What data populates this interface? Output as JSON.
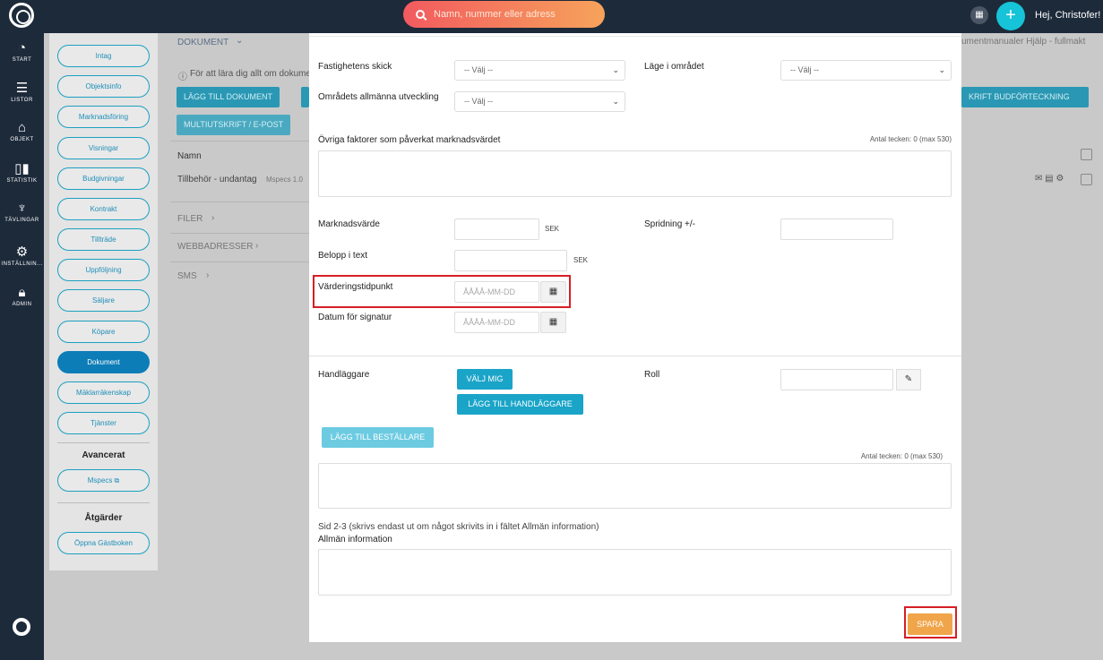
{
  "topbar": {
    "search_placeholder": "Namn, nummer eller adress",
    "greeting": "Hej, Christofer!"
  },
  "leftnav": {
    "items": [
      {
        "label": "START",
        "icon": "speedometer-icon"
      },
      {
        "label": "LISTOR",
        "icon": "list-icon"
      },
      {
        "label": "OBJEKT",
        "icon": "home-icon"
      },
      {
        "label": "STATISTIK",
        "icon": "bar-chart-icon"
      },
      {
        "label": "TÄVLINGAR",
        "icon": "trophy-icon"
      },
      {
        "label": "INSTÄLLNIN...",
        "icon": "gear-icon"
      },
      {
        "label": "ADMIN",
        "icon": "lock-icon"
      }
    ]
  },
  "subnav": {
    "items": [
      "Intag",
      "Objektsinfo",
      "Marknadsföring",
      "Visningar",
      "Budgivningar",
      "Kontrakt",
      "Tillträde",
      "Uppföljning",
      "Säljare",
      "Köpare",
      "Dokument",
      "Mäklarräkenskap",
      "Tjänster"
    ],
    "active": "Dokument",
    "advanced_heading": "Avancerat",
    "mspecs_label": "Mspecs ⧉",
    "actions_heading": "Åtgärder",
    "guestbook_label": "Öppna Gästboken"
  },
  "background": {
    "section_title": "DOKUMENT",
    "info_text": "För att lära dig allt om dokumen",
    "add_doc_button": "LÄGG TILL DOKUMENT",
    "multi_print_button": "MULTIUTSKRIFT / E-POST",
    "print_bid_button": "KRIFT BUDFÖRTECKNING",
    "right_links": "umentmanualer   Hjälp - fullmakt",
    "col_name": "Namn",
    "row1_text": "Tillbehör - undantag",
    "row1_meta": "Mspecs  1.0",
    "filer": "FILER",
    "webbadresser": "WEBBADRESSER",
    "sms": "SMS"
  },
  "modal": {
    "fastighetens_skick_label": "Fastighetens skick",
    "fastighetens_skick_value": "-- Välj --",
    "lage_label": "Läge i området",
    "lage_value": "-- Välj --",
    "omradets_label": "Områdets allmänna utveckling",
    "omradets_value": "-- Välj --",
    "ovriga_label": "Övriga faktorer som påverkat marknadsvärdet",
    "ovriga_counter": "Antal tecken: 0 (max 530)",
    "marknadsvarde_label": "Marknadsvärde",
    "marknadsvarde_suffix": "SEK",
    "spridning_label": "Spridning +/-",
    "belopp_label": "Belopp i text",
    "belopp_suffix": "SEK",
    "vardering_label": "Värderingstidpunkt",
    "vardering_placeholder": "ÅÅÅÅ-MM-DD",
    "signatur_label": "Datum för signatur",
    "signatur_placeholder": "ÅÅÅÅ-MM-DD",
    "handlaggare_label": "Handläggare",
    "valj_mig_button": "VÄLJ MIG",
    "lagg_till_handlaggare_button": "LÄGG TILL HANDLÄGGARE",
    "roll_label": "Roll",
    "lagg_till_bestallare_button": "LÄGG TILL BESTÄLLARE",
    "bestallare_counter": "Antal tecken: 0 (max 530)",
    "sid_note": "Sid 2-3 (skrivs endast ut om något skrivits in i fältet Allmän information)",
    "allman_label": "Allmän information",
    "save_button": "SPARA"
  },
  "colors": {
    "nav_bg": "#1d2a3a",
    "teal": "#1aa4c8",
    "save": "#f0a54a",
    "highlight": "#d61f26"
  }
}
